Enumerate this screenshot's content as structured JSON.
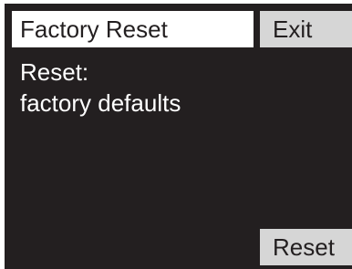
{
  "header": {
    "title": "Factory Reset"
  },
  "softkeys": {
    "top_right_label": "Exit",
    "bottom_right_label": "Reset"
  },
  "message": {
    "line1": "Reset:",
    "line2": "factory defaults"
  },
  "colors": {
    "screen_background": "#231f20",
    "title_background": "#ffffff",
    "softkey_background": "#d6d6d6",
    "body_text": "#ffffff",
    "dark_text": "#231f20"
  }
}
